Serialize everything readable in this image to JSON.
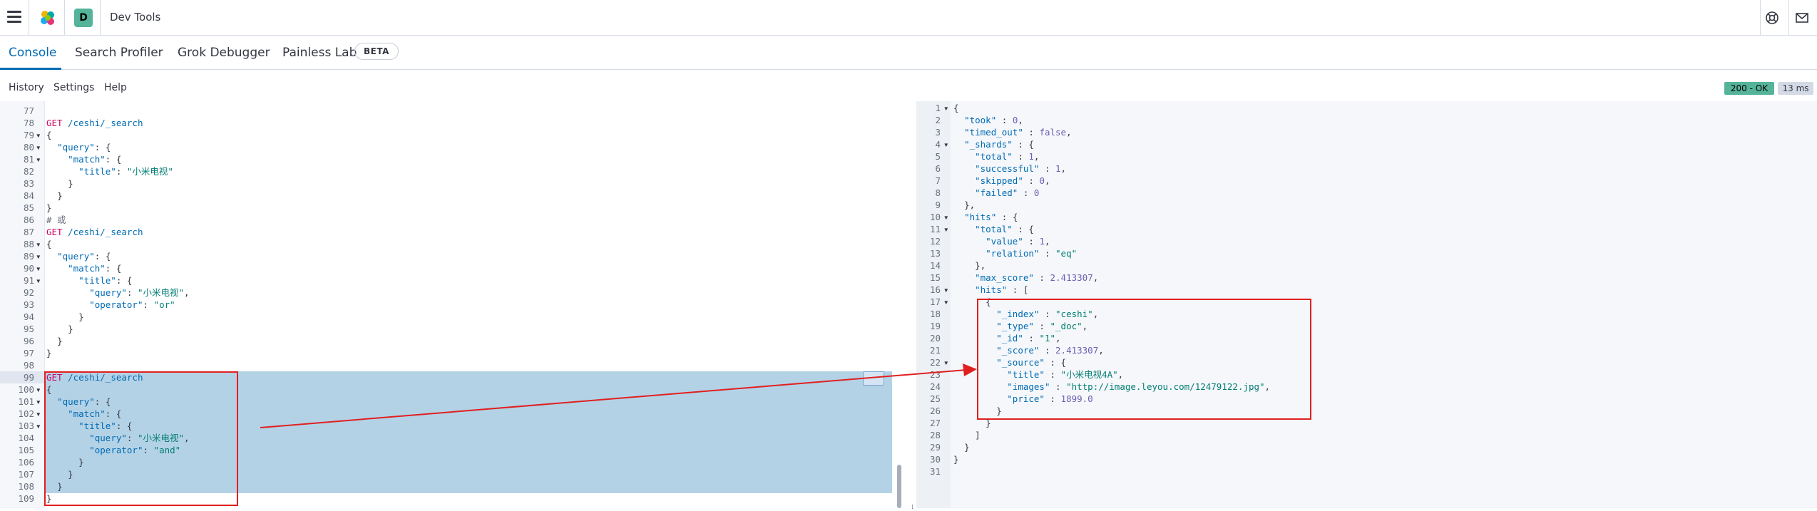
{
  "header": {
    "space_initial": "D",
    "app_title": "Dev Tools",
    "icons": [
      "menu-icon",
      "elastic-logo-icon",
      "help-icon",
      "mail-icon"
    ]
  },
  "tabs": [
    {
      "label": "Console",
      "active": true
    },
    {
      "label": "Search Profiler",
      "active": false
    },
    {
      "label": "Grok Debugger",
      "active": false
    },
    {
      "label": "Painless Lab",
      "active": false
    }
  ],
  "beta_badge": "BETA",
  "toolbar": {
    "history": "History",
    "settings": "Settings",
    "help": "Help"
  },
  "response_status": {
    "code": "200 - OK",
    "time": "13 ms"
  },
  "colors": {
    "accent": "#006bb4",
    "ok": "#54b399",
    "selection": "#b4d2e6",
    "annotation": "#e02020"
  },
  "request_editor": {
    "line_numbers": [
      "77",
      "78",
      "79",
      "80",
      "81",
      "82",
      "83",
      "84",
      "85",
      "86",
      "87",
      "88",
      "89",
      "90",
      "91",
      "92",
      "93",
      "94",
      "95",
      "96",
      "97",
      "98",
      "99",
      "100",
      "101",
      "102",
      "103",
      "104",
      "105",
      "106",
      "107",
      "108",
      "109"
    ],
    "lines": [
      "",
      "GET /ceshi/_search",
      "{",
      "  \"query\": {",
      "    \"match\": {",
      "      \"title\": \"小米电视\"",
      "    }",
      "  }",
      "}",
      "# 或",
      "GET /ceshi/_search",
      "{",
      "  \"query\": {",
      "    \"match\": {",
      "      \"title\": {",
      "        \"query\": \"小米电视\",",
      "        \"operator\": \"or\"",
      "      }",
      "    }",
      "  }",
      "}",
      "",
      "GET /ceshi/_search",
      "{",
      "  \"query\": {",
      "    \"match\": {",
      "      \"title\": {",
      "        \"query\": \"小米电视\",",
      "        \"operator\": \"and\"",
      "      }",
      "    }",
      "  }",
      "}"
    ]
  },
  "response_editor": {
    "line_numbers": [
      "1",
      "2",
      "3",
      "4",
      "5",
      "6",
      "7",
      "8",
      "9",
      "10",
      "11",
      "12",
      "13",
      "14",
      "15",
      "16",
      "17",
      "18",
      "19",
      "20",
      "21",
      "22",
      "23",
      "24",
      "25",
      "26",
      "27",
      "28",
      "29",
      "30",
      "31"
    ],
    "lines": [
      "{",
      "  \"took\" : 0,",
      "  \"timed_out\" : false,",
      "  \"_shards\" : {",
      "    \"total\" : 1,",
      "    \"successful\" : 1,",
      "    \"skipped\" : 0,",
      "    \"failed\" : 0",
      "  },",
      "  \"hits\" : {",
      "    \"total\" : {",
      "      \"value\" : 1,",
      "      \"relation\" : \"eq\"",
      "    },",
      "    \"max_score\" : 2.413307,",
      "    \"hits\" : [",
      "      {",
      "        \"_index\" : \"ceshi\",",
      "        \"_type\" : \"_doc\",",
      "        \"_id\" : \"1\",",
      "        \"_score\" : 2.413307,",
      "        \"_source\" : {",
      "          \"title\" : \"小米电视4A\",",
      "          \"images\" : \"http://image.leyou.com/12479122.jpg\",",
      "          \"price\" : 1899.0",
      "        }",
      "      }",
      "    ]",
      "  }",
      "}",
      ""
    ]
  }
}
